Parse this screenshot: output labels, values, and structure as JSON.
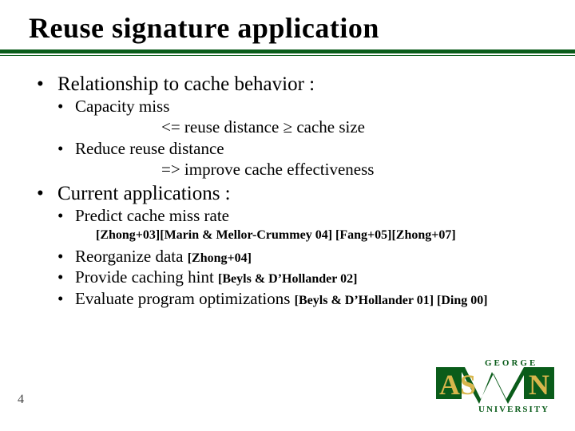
{
  "title": "Reuse signature application",
  "bullets": {
    "b1": {
      "label": "Relationship to cache behavior :",
      "sub": {
        "s1": "Capacity miss",
        "s1_line": "<=  reuse distance  ≥   cache size",
        "s2": "Reduce reuse distance",
        "s2_line": "=>  improve cache effectiveness"
      }
    },
    "b2": {
      "label": "Current applications :",
      "sub": {
        "s1": "Predict cache miss rate",
        "s1_cites": "[Zhong+03][Marin & Mellor-Crummey 04] [Fang+05][Zhong+07]",
        "s2_text": "Reorganize data ",
        "s2_cite": "[Zhong+04]",
        "s3_text": "Provide caching hint ",
        "s3_cite": "[Beyls & D’Hollander 02]",
        "s4_text": "Evaluate program optimizations ",
        "s4_cite": "[Beyls & D’Hollander 01] [Ding 00]"
      }
    }
  },
  "page_number": "4",
  "logo": {
    "top": "GEORGE",
    "bottom_left": "AS",
    "bottom_right": "N",
    "university": "UNIVERSITY"
  }
}
